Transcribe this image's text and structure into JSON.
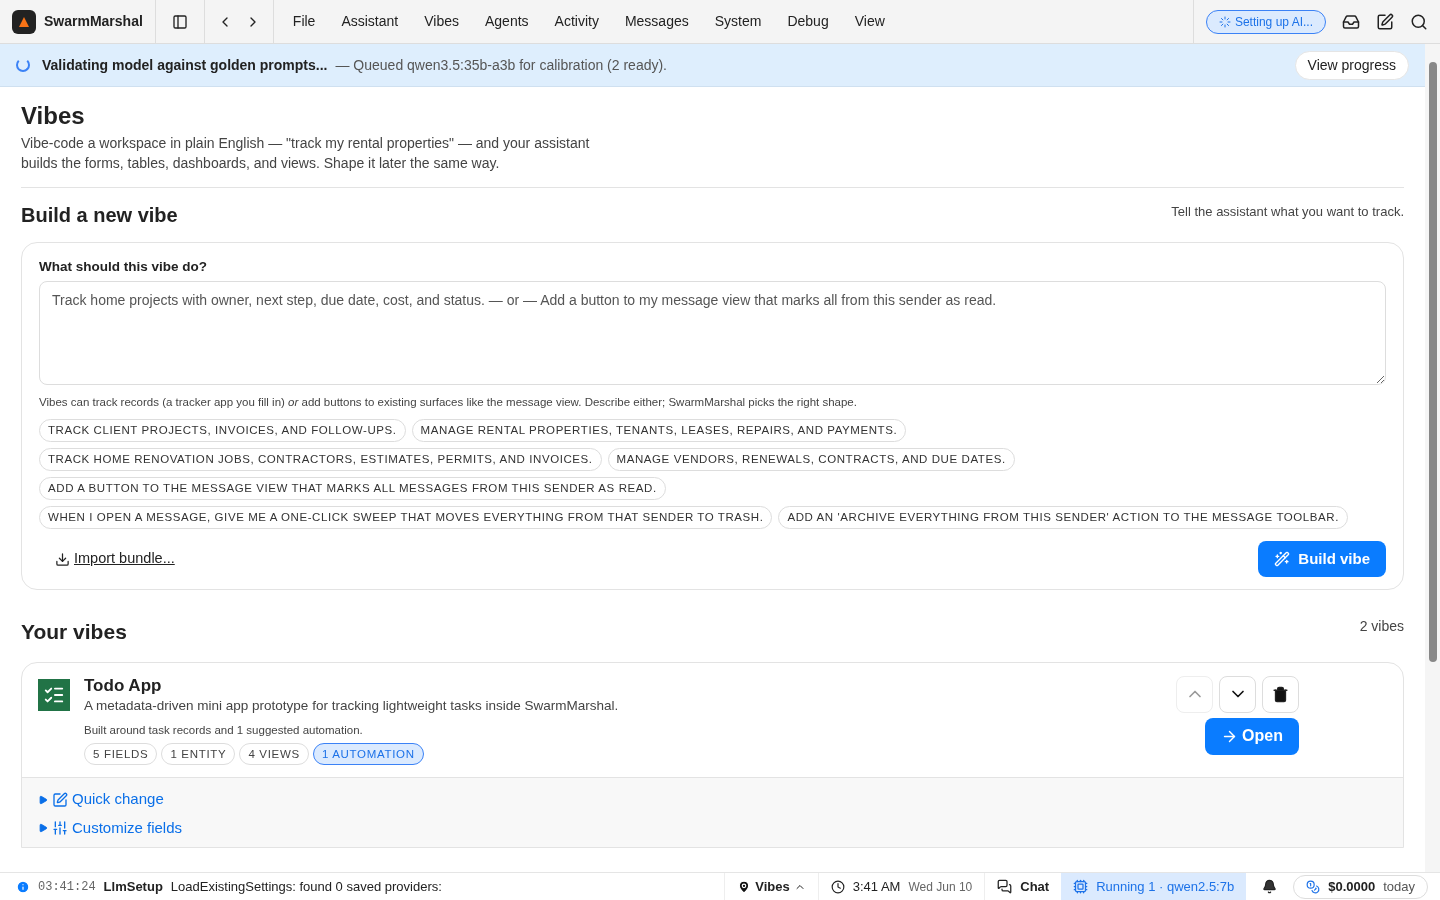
{
  "app": {
    "name": "SwarmMarshal"
  },
  "menu": [
    {
      "label": "File"
    },
    {
      "label": "Assistant"
    },
    {
      "label": "Vibes"
    },
    {
      "label": "Agents"
    },
    {
      "label": "Activity"
    },
    {
      "label": "Messages"
    },
    {
      "label": "System"
    },
    {
      "label": "Debug"
    },
    {
      "label": "View"
    }
  ],
  "status_pill": {
    "label": "Setting up AI..."
  },
  "banner": {
    "title": "Validating model against golden prompts...",
    "detail": "— Queued qwen3.5:35b-a3b for calibration (2 ready).",
    "button": "View progress"
  },
  "page": {
    "title": "Vibes",
    "intro": "Vibe-code a workspace in plain English — \"track my rental properties\" — and your assistant builds the forms, tables, dashboards, and views. Shape it later the same way."
  },
  "builder": {
    "title": "Build a new vibe",
    "hint": "Tell the assistant what you want to track.",
    "field_label": "What should this vibe do?",
    "placeholder": "Track home projects with owner, next step, due date, cost, and status. — or — Add a button to my message view that marks all from this sender as read.",
    "help": "Vibes can track records (a tracker app you fill in) *or* add buttons to existing surfaces like the message view. Describe either; SwarmMarshal picks the right shape.",
    "suggestions": [
      "TRACK CLIENT PROJECTS, INVOICES, AND FOLLOW-UPS.",
      "MANAGE RENTAL PROPERTIES, TENANTS, LEASES, REPAIRS, AND PAYMENTS.",
      "TRACK HOME RENOVATION JOBS, CONTRACTORS, ESTIMATES, PERMITS, AND INVOICES.",
      "MANAGE VENDORS, RENEWALS, CONTRACTS, AND DUE DATES.",
      "ADD A BUTTON TO THE MESSAGE VIEW THAT MARKS ALL MESSAGES FROM THIS SENDER AS READ.",
      "WHEN I OPEN A MESSAGE, GIVE ME A ONE-CLICK SWEEP THAT MOVES EVERYTHING FROM THAT SENDER TO TRASH.",
      "ADD AN 'ARCHIVE EVERYTHING FROM THIS SENDER' ACTION TO THE MESSAGE TOOLBAR."
    ],
    "import": "Import bundle...",
    "build": "Build vibe"
  },
  "vibes": {
    "title": "Your vibes",
    "count": "2 vibes",
    "items": [
      {
        "name": "Todo App",
        "description": "A metadata-driven mini app prototype for tracking lightweight tasks inside SwarmMarshal.",
        "summary": "Built around task records and 1 suggested automation.",
        "tags": [
          {
            "label": "5 FIELDS",
            "selected": false
          },
          {
            "label": "1 ENTITY",
            "selected": false
          },
          {
            "label": "4 VIEWS",
            "selected": false
          },
          {
            "label": "1 AUTOMATION",
            "selected": true
          }
        ],
        "move_up_disabled": true,
        "move_down_disabled": false,
        "open": "Open",
        "sections": [
          {
            "label": "Quick change",
            "expanded": false,
            "kind": "edit"
          },
          {
            "label": "Customize fields",
            "expanded": false,
            "kind": "sliders"
          }
        ]
      }
    ]
  },
  "status_bar": {
    "time": "03:41:24",
    "source": "LlmSetup",
    "message": "LoadExistingSettings: found 0 saved providers:",
    "location": "Vibes",
    "clock": "3:41 AM",
    "date": "Wed Jun 10",
    "chat": "Chat",
    "running": "Running 1 · qwen2.5:7b",
    "cost": "$0.0000",
    "cost_period": "today"
  }
}
